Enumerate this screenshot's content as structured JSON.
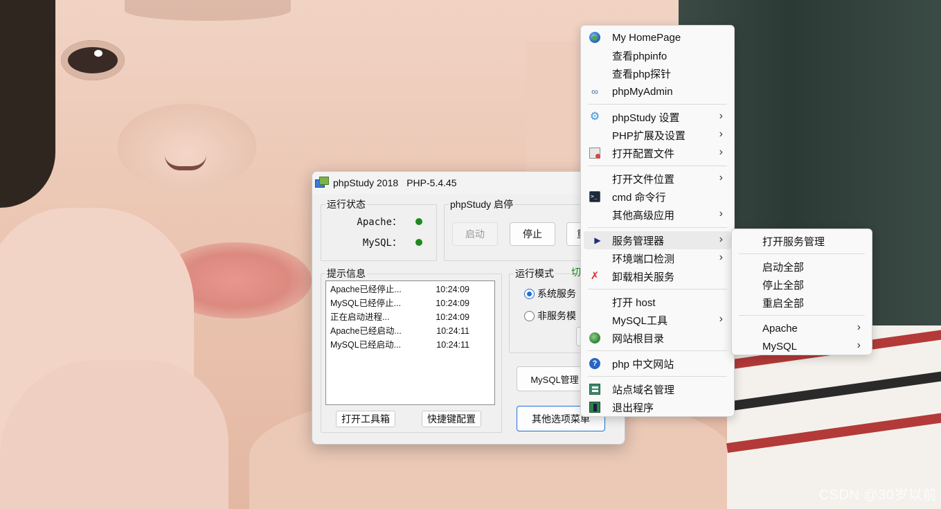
{
  "watermark": "CSDN @30岁以前",
  "window": {
    "title": "phpStudy 2018",
    "php_version": "PHP-5.4.45",
    "status_group": {
      "legend": "运行状态",
      "rows": [
        {
          "label": "Apache：",
          "status_color": "#1e8a1e"
        },
        {
          "label": "MySQL：",
          "status_color": "#1e8a1e"
        }
      ]
    },
    "run_group": {
      "legend_a": "phpStudy",
      "legend_b": "启停",
      "start_label": "启动",
      "stop_label": "停止",
      "restart_label": "重"
    },
    "info_group": {
      "legend": "提示信息",
      "log": [
        {
          "msg": "Apache已经停止...",
          "time": "10:24:09"
        },
        {
          "msg": "MySQL已经停止...",
          "time": "10:24:09"
        },
        {
          "msg": "正在启动进程...",
          "time": "10:24:09"
        },
        {
          "msg": "Apache已经启动...",
          "time": "10:24:11"
        },
        {
          "msg": "MySQL已经启动...",
          "time": "10:24:11"
        }
      ],
      "toolbox_label": "打开工具箱",
      "shortcut_label": "快捷键配置"
    },
    "mode_group": {
      "legend": "运行模式",
      "switch_label": "切",
      "option_service": "系统服务",
      "option_nonservice": "非服务模",
      "selected": "系统服务"
    },
    "mysql_manager_label": "MySQL管理",
    "other_menu_label": "其他选项菜单"
  },
  "context_menu": {
    "items": [
      {
        "label": "My HomePage",
        "icon": "globe-icon"
      },
      {
        "label": "查看phpinfo",
        "icon": ""
      },
      {
        "label": "查看php探针",
        "icon": ""
      },
      {
        "label": "phpMyAdmin",
        "icon": "rings-icon"
      },
      {
        "label": "phpStudy 设置",
        "icon": "gear-icon",
        "submenu": true
      },
      {
        "label": "PHP扩展及设置",
        "icon": "",
        "submenu": true
      },
      {
        "label": "打开配置文件",
        "icon": "config-file-icon",
        "submenu": true
      },
      {
        "label": "打开文件位置",
        "icon": "",
        "submenu": true
      },
      {
        "label": "cmd 命令行",
        "icon": "cmd-icon"
      },
      {
        "label": "其他高级应用",
        "icon": "",
        "submenu": true
      },
      {
        "label": "服务管理器",
        "icon": "triangle-icon",
        "submenu": true,
        "highlighted": true
      },
      {
        "label": "环境端口检测",
        "icon": "",
        "submenu": true
      },
      {
        "label": "卸载相关服务",
        "icon": "uninstall-icon"
      },
      {
        "label": "打开 host",
        "icon": ""
      },
      {
        "label": "MySQL工具",
        "icon": "",
        "submenu": true
      },
      {
        "label": "网站根目录",
        "icon": "web-root-icon"
      },
      {
        "label": "php 中文网站",
        "icon": "help-icon"
      },
      {
        "label": "站点域名管理",
        "icon": "site-icon"
      },
      {
        "label": "退出程序",
        "icon": "exit-icon"
      }
    ]
  },
  "service_submenu": {
    "items": [
      {
        "label": "打开服务管理"
      },
      {
        "label": "启动全部"
      },
      {
        "label": "停止全部"
      },
      {
        "label": "重启全部"
      },
      {
        "label": "Apache",
        "submenu": true
      },
      {
        "label": "MySQL",
        "submenu": true
      }
    ]
  },
  "chevron": "›"
}
